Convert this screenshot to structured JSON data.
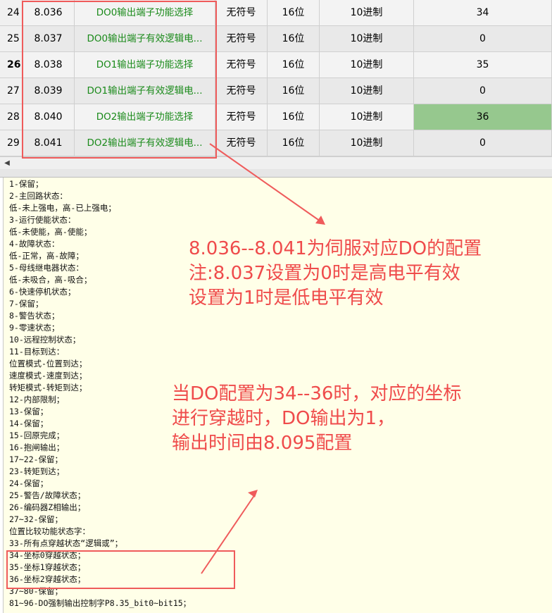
{
  "table": {
    "rows": [
      {
        "idx": "24",
        "addr": "8.036",
        "name": "DO0输出端子功能选择",
        "type": "无符号",
        "bits": "16位",
        "fmt": "10进制",
        "val": "34"
      },
      {
        "idx": "25",
        "addr": "8.037",
        "name": "DO0输出端子有效逻辑电...",
        "type": "无符号",
        "bits": "16位",
        "fmt": "10进制",
        "val": "0"
      },
      {
        "idx": "26",
        "addr": "8.038",
        "name": "DO1输出端子功能选择",
        "type": "无符号",
        "bits": "16位",
        "fmt": "10进制",
        "val": "35"
      },
      {
        "idx": "27",
        "addr": "8.039",
        "name": "DO1输出端子有效逻辑电...",
        "type": "无符号",
        "bits": "16位",
        "fmt": "10进制",
        "val": "0"
      },
      {
        "idx": "28",
        "addr": "8.040",
        "name": "DO2输出端子功能选择",
        "type": "无符号",
        "bits": "16位",
        "fmt": "10进制",
        "val": "36"
      },
      {
        "idx": "29",
        "addr": "8.041",
        "name": "DO2输出端子有效逻辑电...",
        "type": "无符号",
        "bits": "16位",
        "fmt": "10进制",
        "val": "0"
      }
    ],
    "selected_row_index": "26",
    "highlight_color": "#96c88e",
    "name_color": "#1a8a1a"
  },
  "scrollbar": {
    "left_arrow_icon": "triangle-left-icon",
    "left_arrow_glyph": "◀"
  },
  "description": {
    "lines": [
      "1-保留；",
      "2-主回路状态：",
      "低-未上强电，高-已上强电；",
      "3-运行使能状态：",
      "低-未使能，高-使能；",
      "4-故障状态：",
      "低-正常，高-故障；",
      "5-母线继电器状态：",
      "低-未吸合，高-吸合；",
      "6-快速停机状态；",
      "7-保留；",
      "8-警告状态；",
      "9-零速状态；",
      "10-远程控制状态；",
      "11-目标到达：",
      "位置模式-位置到达；",
      "速度模式-速度到达；",
      "转矩模式-转矩到达；",
      "12-内部限制；",
      "13-保留；",
      "14-保留；",
      "15-回原完成；",
      "16-抱闸输出；",
      "17~22-保留；",
      "23-转矩到达；",
      "24-保留；",
      "25-警告/故障状态；",
      "26-编码器Z相输出；",
      "27~32-保留；",
      "位置比较功能状态字：",
      "33-所有点穿越状态“逻辑或”；",
      "34-坐标0穿越状态；",
      "35-坐标1穿越状态；",
      "36-坐标2穿越状态；",
      "37~80-保留；",
      "81~96-DO强制输出控制字P8.35_bit0~bit15；"
    ]
  },
  "annotations": {
    "note1": [
      "8.036--8.041为伺服对应DO的配置",
      "注:8.037设置为0时是高电平有效",
      "设置为1时是低电平有效"
    ],
    "note2": [
      "当DO配置为34--36时，对应的坐标",
      "进行穿越时，DO输出为1，",
      "输出时间由8.095配置"
    ],
    "color": "#ef4b4b"
  }
}
